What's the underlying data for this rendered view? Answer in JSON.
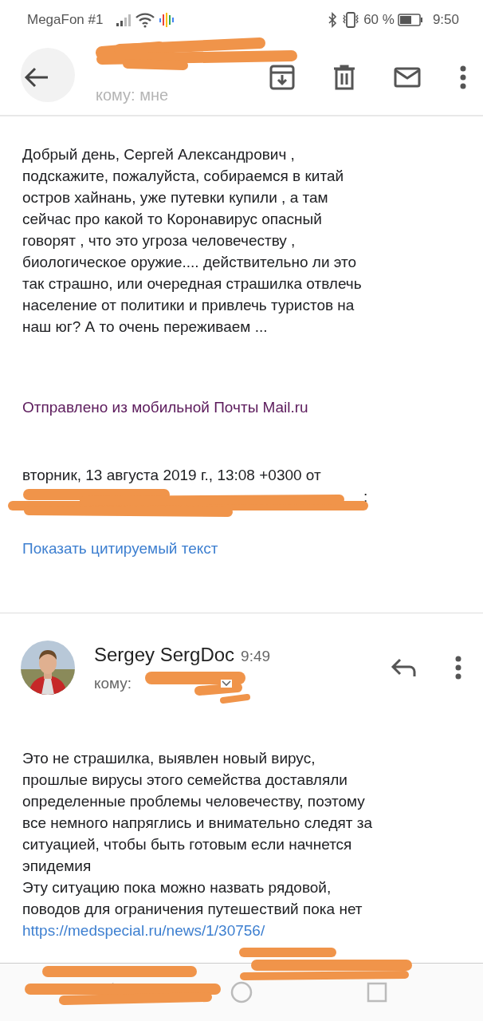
{
  "status_bar": {
    "carrier": "MegaFon #1",
    "battery_percent": "60 %",
    "time": "9:50"
  },
  "header": {
    "faded_recipient": "кому: мне"
  },
  "first_message": {
    "paragraph": "Добрый день, Сергей Александрович ,\nподскажите, пожалуйста, собираемся в китай\nостров хайнань,  уже путевки купили , а там\nсейчас про  какой то Коронавирус опасный\nговорят , что это угроза человечеству ,\nбиологическое оружие.... действительно ли это\nтак страшно, или очередная страшилка отвлечь\nнаселение от политики и привлечь туристов на\nнаш юг? А то очень переживаем ...",
    "signature": "Отправлено из мобильной Почты Mail.ru",
    "quote_header": "вторник, 13 августа 2019 г., 13:08 +0300 от",
    "quote_header_end": ":",
    "show_quoted": "Показать цитируемый текст"
  },
  "second_message": {
    "sender": "Sergey SergDoc",
    "time": "9:49",
    "recipient_label": "кому:",
    "body": "Это не страшилка, выявлен новый вирус,\nпрошлые вирусы этого семейства доставляли\nопределенные проблемы человечеству, поэтому\nвсе немного напряглись и внимательно следят за\nситуацией, чтобы быть готовым если начнется\nэпидемия\nЭту ситуацию пока можно назвать рядовой,\nповодов для ограничения путешествий пока нет",
    "link": "https://medspecial.ru/news/1/30756/"
  }
}
